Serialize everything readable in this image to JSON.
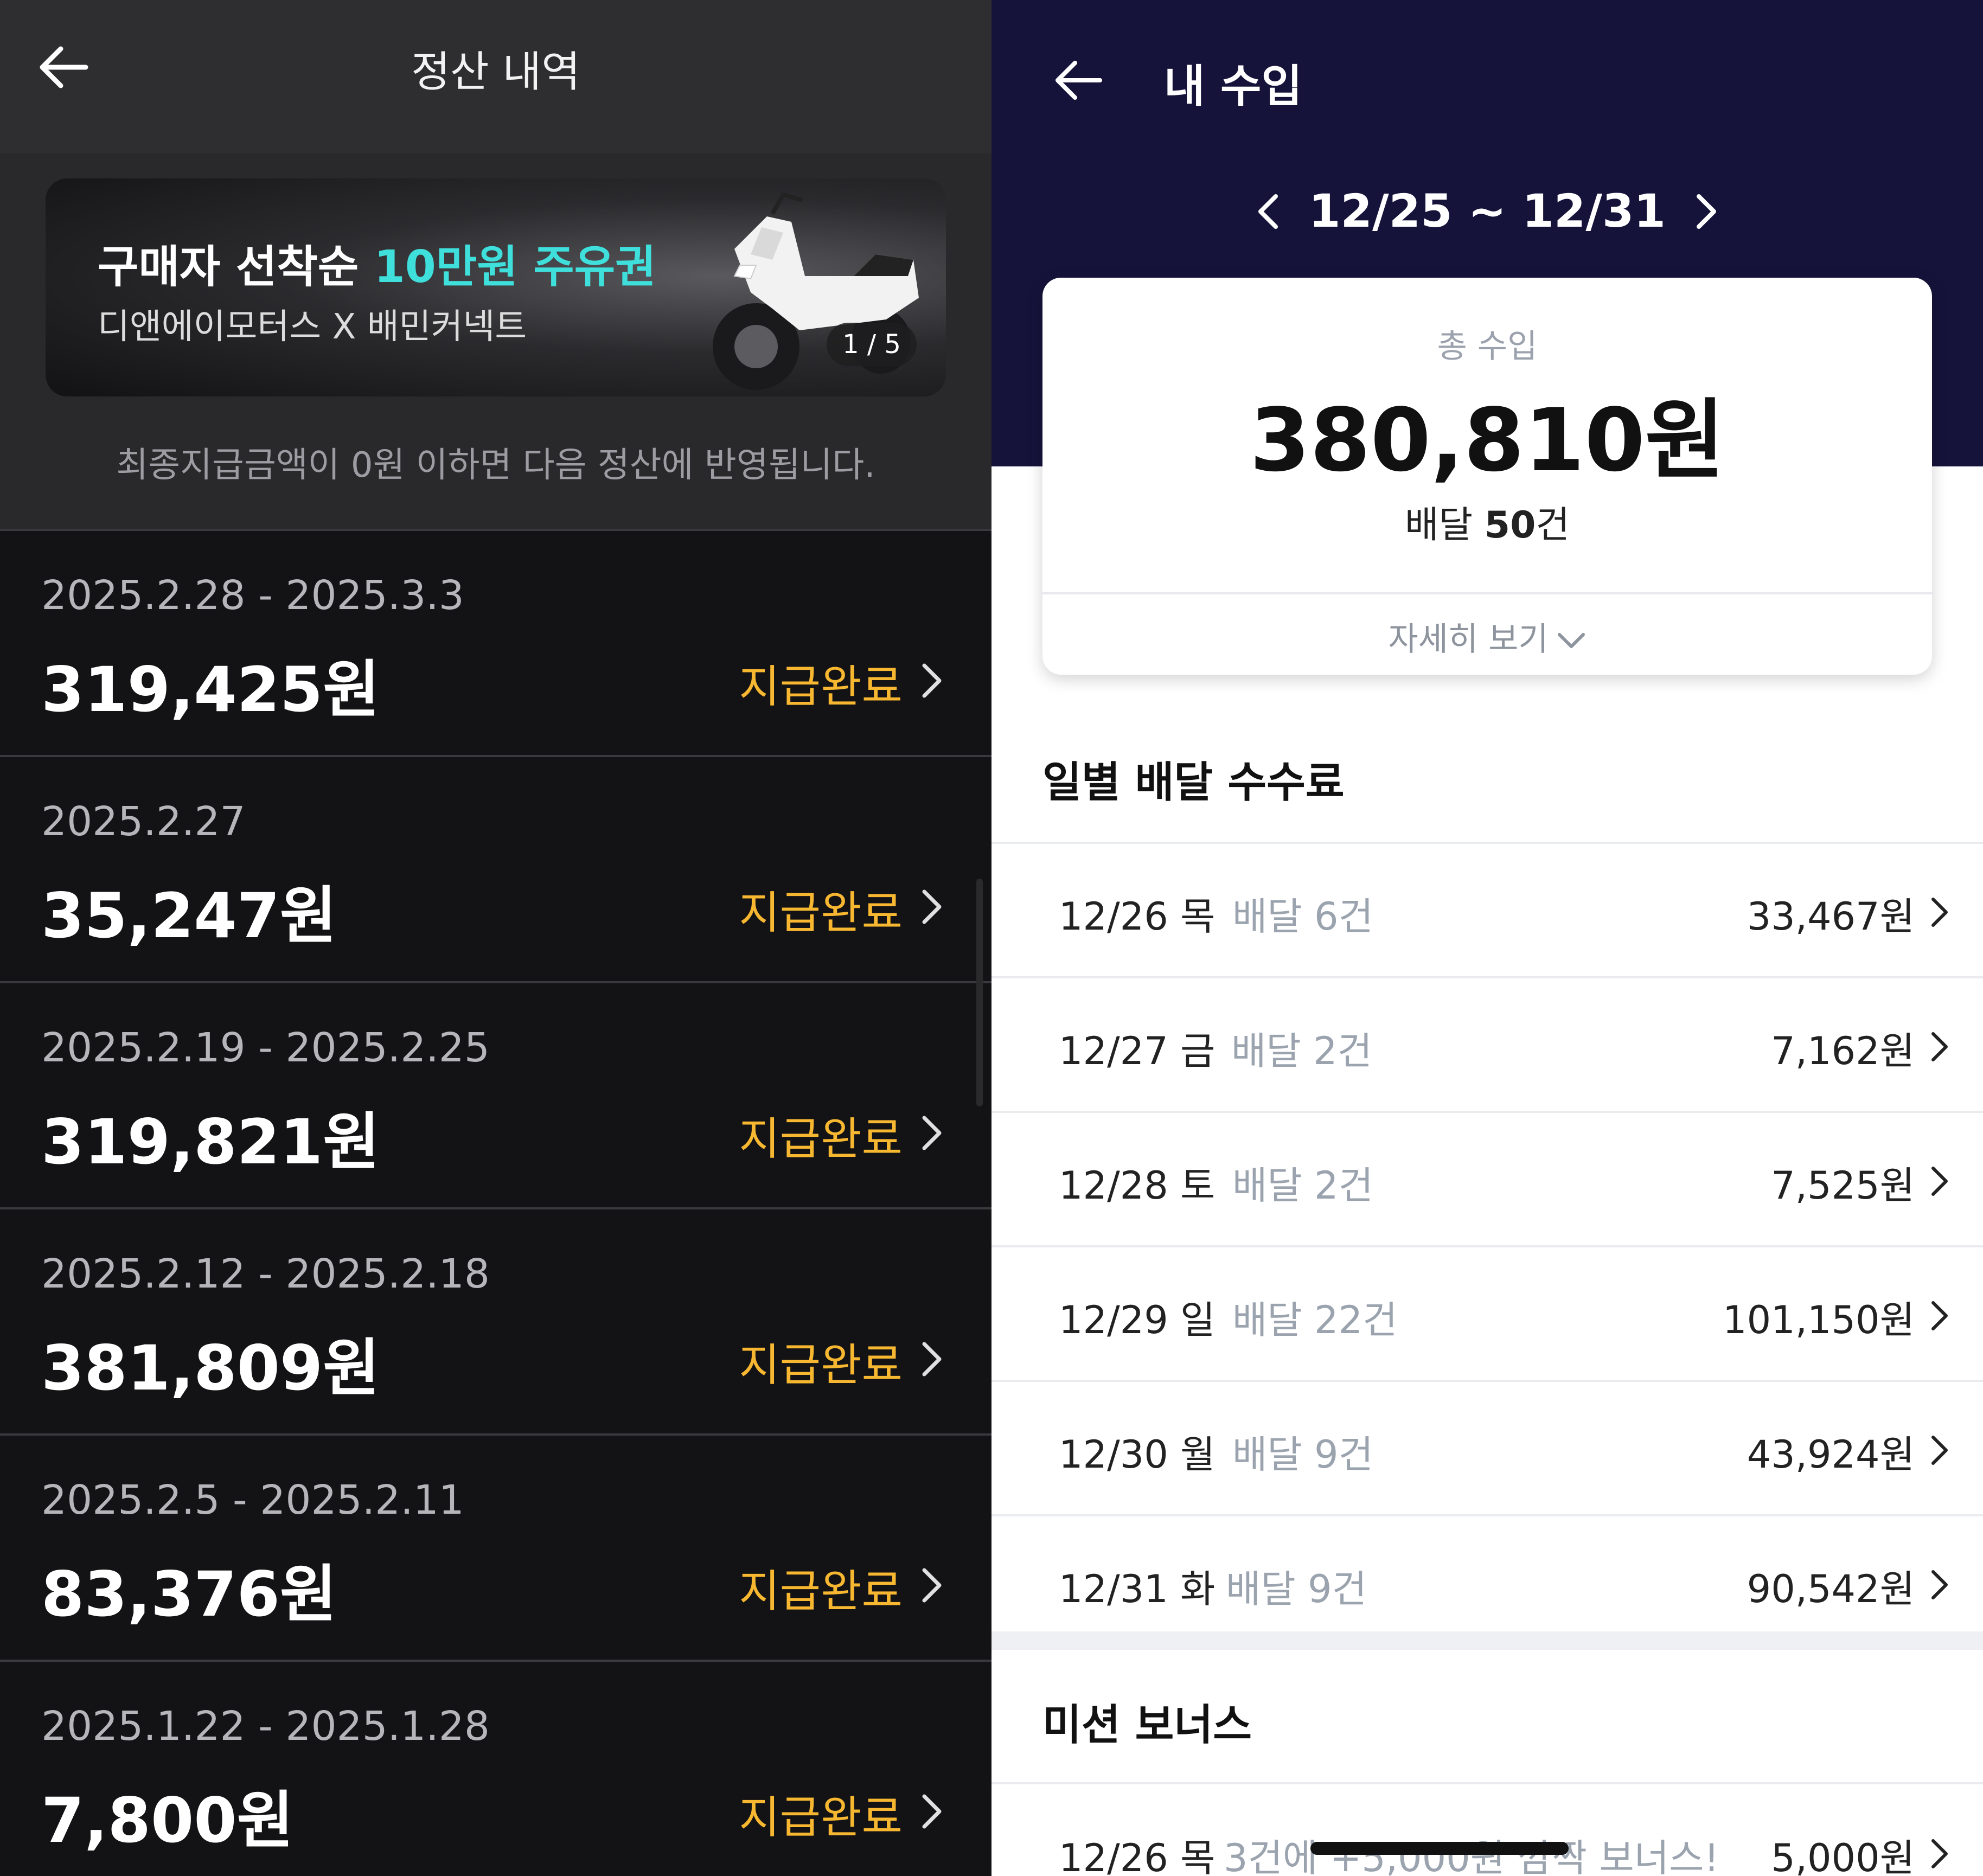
{
  "left": {
    "header": {
      "title": "정산 내역"
    },
    "banner": {
      "line1_prefix": "구매자 선착순 ",
      "line1_highlight": "10만원 주유권",
      "line2": "디앤에이모터스 X 배민커넥트",
      "pager": "1 / 5",
      "highlight_color": "#3fe0dc"
    },
    "notice": "최종지급금액이 0원 이하면 다음 정산에 반영됩니다.",
    "settlements": [
      {
        "date": "2025.2.28 - 2025.3.3",
        "amount": "319,425원",
        "status": "지급완료"
      },
      {
        "date": "2025.2.27",
        "amount": "35,247원",
        "status": "지급완료"
      },
      {
        "date": "2025.2.19 - 2025.2.25",
        "amount": "319,821원",
        "status": "지급완료"
      },
      {
        "date": "2025.2.12 - 2025.2.18",
        "amount": "381,809원",
        "status": "지급완료"
      },
      {
        "date": "2025.2.5 - 2025.2.11",
        "amount": "83,376원",
        "status": "지급완료"
      },
      {
        "date": "2025.1.22 - 2025.1.28",
        "amount": "7,800원",
        "status": "지급완료"
      }
    ],
    "status_color": "#f7b731"
  },
  "right": {
    "header": {
      "title": "내 수입"
    },
    "range": "12/25 ~ 12/31",
    "summary": {
      "total_label": "총 수입",
      "total_value": "380,810원",
      "delivery_prefix": "배달 ",
      "delivery_count": "50",
      "delivery_suffix": "건",
      "detail_label": "자세히 보기"
    },
    "daily_title": "일별 배달 수수료",
    "daily": [
      {
        "day": "12/26 목",
        "count": "배달 6건",
        "amount": "33,467원"
      },
      {
        "day": "12/27 금",
        "count": "배달 2건",
        "amount": "7,162원"
      },
      {
        "day": "12/28 토",
        "count": "배달 2건",
        "amount": "7,525원"
      },
      {
        "day": "12/29 일",
        "count": "배달 22건",
        "amount": "101,150원"
      },
      {
        "day": "12/30 월",
        "count": "배달 9건",
        "amount": "43,924원"
      },
      {
        "day": "12/31 화",
        "count": "배달 9건",
        "amount": "90,542원"
      }
    ],
    "bonus_title": "미션 보너스",
    "bonus": [
      {
        "day": "12/26 목",
        "count": "3건에 +5,000원 깜짝 보너스!",
        "amount": "5,000원"
      }
    ],
    "header_color": "#15133a"
  }
}
